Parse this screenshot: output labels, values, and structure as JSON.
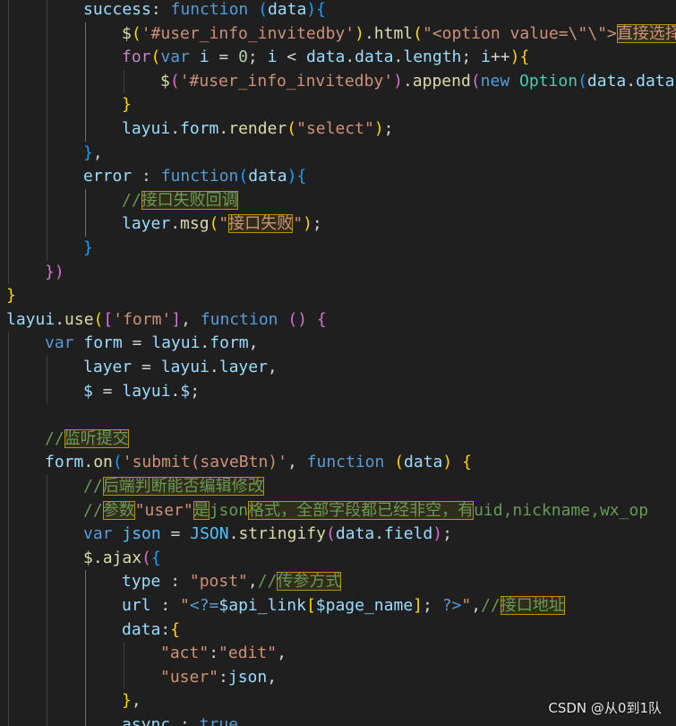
{
  "editor": {
    "colors": {
      "background": "#1f1f1f",
      "identifier": "#9cdcfe",
      "function": "#dcdcaa",
      "keyword": "#569cd6",
      "control": "#c586c0",
      "string": "#ce9178",
      "number": "#b5cea8",
      "comment": "#6a9955",
      "punctuation": "#d4d4d4",
      "bracket1": "#ffd700",
      "bracket2": "#da70d6",
      "bracket3": "#179fff",
      "constant": "#4fc1ff",
      "class": "#4ec9b0",
      "highlight_border": "#b89500"
    },
    "lines": [
      {
        "indent": 2,
        "tokens": [
          [
            "ident",
            "success"
          ],
          [
            "punc",
            ": "
          ],
          [
            "kw",
            "function"
          ],
          [
            "punc",
            " "
          ],
          [
            "p3",
            "("
          ],
          [
            "ident",
            "data"
          ],
          [
            "p3",
            ")"
          ],
          [
            "p3",
            "{"
          ]
        ]
      },
      {
        "indent": 3,
        "tokens": [
          [
            "func",
            "$"
          ],
          [
            "p1",
            "("
          ],
          [
            "str",
            "'#user_info_invitedby'"
          ],
          [
            "p1",
            ")"
          ],
          [
            "punc",
            "."
          ],
          [
            "func",
            "html"
          ],
          [
            "p1",
            "("
          ],
          [
            "str",
            "\"<option value=\\\"\\\">"
          ],
          [
            "str",
            "直接选择",
            "hl"
          ]
        ]
      },
      {
        "indent": 3,
        "tokens": [
          [
            "ctrl",
            "for"
          ],
          [
            "p1",
            "("
          ],
          [
            "kw",
            "var"
          ],
          [
            "punc",
            " "
          ],
          [
            "ident",
            "i"
          ],
          [
            "punc",
            " = "
          ],
          [
            "num",
            "0"
          ],
          [
            "punc",
            "; "
          ],
          [
            "ident",
            "i"
          ],
          [
            "punc",
            " < "
          ],
          [
            "ident",
            "data"
          ],
          [
            "punc",
            "."
          ],
          [
            "ident",
            "data"
          ],
          [
            "punc",
            "."
          ],
          [
            "ident",
            "length"
          ],
          [
            "punc",
            "; "
          ],
          [
            "ident",
            "i"
          ],
          [
            "punc",
            "++"
          ],
          [
            "p1",
            ")"
          ],
          [
            "p1",
            "{"
          ]
        ]
      },
      {
        "indent": 4,
        "tokens": [
          [
            "func",
            "$"
          ],
          [
            "p2",
            "("
          ],
          [
            "str",
            "'#user_info_invitedby'"
          ],
          [
            "p2",
            ")"
          ],
          [
            "punc",
            "."
          ],
          [
            "func",
            "append"
          ],
          [
            "p2",
            "("
          ],
          [
            "kw",
            "new"
          ],
          [
            "punc",
            " "
          ],
          [
            "cls",
            "Option"
          ],
          [
            "p3",
            "("
          ],
          [
            "ident",
            "data"
          ],
          [
            "punc",
            "."
          ],
          [
            "ident",
            "data"
          ],
          [
            "p1",
            "["
          ]
        ]
      },
      {
        "indent": 3,
        "tokens": [
          [
            "p1",
            "}"
          ]
        ]
      },
      {
        "indent": 3,
        "tokens": [
          [
            "ident",
            "layui"
          ],
          [
            "punc",
            "."
          ],
          [
            "ident",
            "form"
          ],
          [
            "punc",
            "."
          ],
          [
            "func",
            "render"
          ],
          [
            "p1",
            "("
          ],
          [
            "str",
            "\"select\""
          ],
          [
            "p1",
            ")"
          ],
          [
            "punc",
            ";"
          ]
        ]
      },
      {
        "indent": 2,
        "tokens": [
          [
            "p3",
            "}"
          ],
          [
            "punc",
            ","
          ]
        ]
      },
      {
        "indent": 2,
        "tokens": [
          [
            "ident",
            "error"
          ],
          [
            "punc",
            " : "
          ],
          [
            "kw",
            "function"
          ],
          [
            "p3",
            "("
          ],
          [
            "ident",
            "data"
          ],
          [
            "p3",
            ")"
          ],
          [
            "p3",
            "{"
          ]
        ]
      },
      {
        "indent": 3,
        "tokens": [
          [
            "cmt",
            "//"
          ],
          [
            "cmt",
            "接口失败回调",
            "hl"
          ]
        ]
      },
      {
        "indent": 3,
        "tokens": [
          [
            "ident",
            "layer"
          ],
          [
            "punc",
            "."
          ],
          [
            "func",
            "msg"
          ],
          [
            "p1",
            "("
          ],
          [
            "str",
            "\""
          ],
          [
            "str",
            "接口失败",
            "hl"
          ],
          [
            "str",
            "\""
          ],
          [
            "p1",
            ")"
          ],
          [
            "punc",
            ";"
          ]
        ]
      },
      {
        "indent": 2,
        "tokens": [
          [
            "p3",
            "}"
          ]
        ]
      },
      {
        "indent": 1,
        "tokens": [
          [
            "p2",
            "}"
          ],
          [
            "p2",
            ")"
          ]
        ]
      },
      {
        "indent": 0,
        "tokens": [
          [
            "p1",
            "}"
          ]
        ]
      },
      {
        "indent": 0,
        "tokens": [
          [
            "ident",
            "layui"
          ],
          [
            "punc",
            "."
          ],
          [
            "func",
            "use"
          ],
          [
            "p1",
            "("
          ],
          [
            "p2",
            "["
          ],
          [
            "str",
            "'form'"
          ],
          [
            "p2",
            "]"
          ],
          [
            "punc",
            ", "
          ],
          [
            "kw",
            "function"
          ],
          [
            "punc",
            " "
          ],
          [
            "p2",
            "("
          ],
          [
            "p2",
            ")"
          ],
          [
            "punc",
            " "
          ],
          [
            "p2",
            "{"
          ]
        ]
      },
      {
        "indent": 1,
        "tokens": [
          [
            "kw",
            "var"
          ],
          [
            "punc",
            " "
          ],
          [
            "ident",
            "form"
          ],
          [
            "punc",
            " = "
          ],
          [
            "ident",
            "layui"
          ],
          [
            "punc",
            "."
          ],
          [
            "ident",
            "form"
          ],
          [
            "punc",
            ","
          ]
        ]
      },
      {
        "indent": 2,
        "tokens": [
          [
            "ident",
            "layer"
          ],
          [
            "punc",
            " = "
          ],
          [
            "ident",
            "layui"
          ],
          [
            "punc",
            "."
          ],
          [
            "ident",
            "layer"
          ],
          [
            "punc",
            ","
          ]
        ]
      },
      {
        "indent": 2,
        "tokens": [
          [
            "ident",
            "$"
          ],
          [
            "punc",
            " = "
          ],
          [
            "ident",
            "layui"
          ],
          [
            "punc",
            "."
          ],
          [
            "ident",
            "$"
          ],
          [
            "punc",
            ";"
          ]
        ]
      },
      {
        "indent": 0,
        "tokens": []
      },
      {
        "indent": 1,
        "tokens": [
          [
            "cmt",
            "//"
          ],
          [
            "cmt",
            "监听提交",
            "hl"
          ]
        ]
      },
      {
        "indent": 1,
        "tokens": [
          [
            "ident",
            "form"
          ],
          [
            "punc",
            "."
          ],
          [
            "func",
            "on"
          ],
          [
            "p3",
            "("
          ],
          [
            "str",
            "'submit(saveBtn)'"
          ],
          [
            "punc",
            ", "
          ],
          [
            "kw",
            "function"
          ],
          [
            "punc",
            " "
          ],
          [
            "p1",
            "("
          ],
          [
            "ident",
            "data"
          ],
          [
            "p1",
            ")"
          ],
          [
            "punc",
            " "
          ],
          [
            "p1",
            "{"
          ]
        ]
      },
      {
        "indent": 2,
        "tokens": [
          [
            "cmt",
            "//"
          ],
          [
            "cmt",
            "后端判断能否编辑修改",
            "hl"
          ]
        ]
      },
      {
        "indent": 2,
        "tokens": [
          [
            "cmt",
            "//"
          ],
          [
            "cmt",
            "参数",
            "hl"
          ],
          [
            "str",
            "\"user\""
          ],
          [
            "cmt",
            "是",
            "hl"
          ],
          [
            "cmt",
            "json"
          ],
          [
            "cmt",
            "格式，全部字段都已经非空，有",
            "hl"
          ],
          [
            "cmt",
            "uid,nickname,wx_op"
          ]
        ]
      },
      {
        "indent": 2,
        "tokens": [
          [
            "kw",
            "var"
          ],
          [
            "punc",
            " "
          ],
          [
            "const",
            "json"
          ],
          [
            "punc",
            " = "
          ],
          [
            "const",
            "JSON"
          ],
          [
            "punc",
            "."
          ],
          [
            "func",
            "stringify"
          ],
          [
            "p2",
            "("
          ],
          [
            "ident",
            "data"
          ],
          [
            "punc",
            "."
          ],
          [
            "ident",
            "field"
          ],
          [
            "p2",
            ")"
          ],
          [
            "punc",
            ";"
          ]
        ]
      },
      {
        "indent": 2,
        "tokens": [
          [
            "func",
            "$"
          ],
          [
            "punc",
            "."
          ],
          [
            "func",
            "ajax"
          ],
          [
            "p2",
            "("
          ],
          [
            "p3",
            "{"
          ]
        ]
      },
      {
        "indent": 3,
        "tokens": [
          [
            "ident",
            "type"
          ],
          [
            "punc",
            " : "
          ],
          [
            "str",
            "\"post\""
          ],
          [
            "punc",
            ","
          ],
          [
            "cmt",
            "//"
          ],
          [
            "cmt",
            "传参方式",
            "hl"
          ]
        ]
      },
      {
        "indent": 3,
        "tokens": [
          [
            "ident",
            "url"
          ],
          [
            "punc",
            " : "
          ],
          [
            "str",
            "\""
          ],
          [
            "kw",
            "<?="
          ],
          [
            "ident",
            "$api_link"
          ],
          [
            "p1",
            "["
          ],
          [
            "ident",
            "$page_name"
          ],
          [
            "p1",
            "]"
          ],
          [
            "punc",
            "; "
          ],
          [
            "kw",
            "?>"
          ],
          [
            "str",
            "\""
          ],
          [
            "punc",
            ","
          ],
          [
            "cmt",
            "//"
          ],
          [
            "cmt",
            "接口地址",
            "hl"
          ]
        ]
      },
      {
        "indent": 3,
        "tokens": [
          [
            "ident",
            "data"
          ],
          [
            "punc",
            ":"
          ],
          [
            "p1",
            "{"
          ]
        ]
      },
      {
        "indent": 4,
        "tokens": [
          [
            "str",
            "\"act\""
          ],
          [
            "punc",
            ":"
          ],
          [
            "str",
            "\"edit\""
          ],
          [
            "punc",
            ","
          ]
        ]
      },
      {
        "indent": 4,
        "tokens": [
          [
            "str",
            "\"user\""
          ],
          [
            "punc",
            ":"
          ],
          [
            "ident",
            "json"
          ],
          [
            "punc",
            ","
          ]
        ]
      },
      {
        "indent": 3,
        "tokens": [
          [
            "p1",
            "}"
          ],
          [
            "punc",
            ","
          ]
        ]
      },
      {
        "indent": 3,
        "tokens": [
          [
            "ident",
            "async"
          ],
          [
            "punc",
            " : "
          ],
          [
            "kw",
            "true"
          ]
        ]
      }
    ]
  },
  "watermark": {
    "text": "CSDN @从0到1队"
  }
}
